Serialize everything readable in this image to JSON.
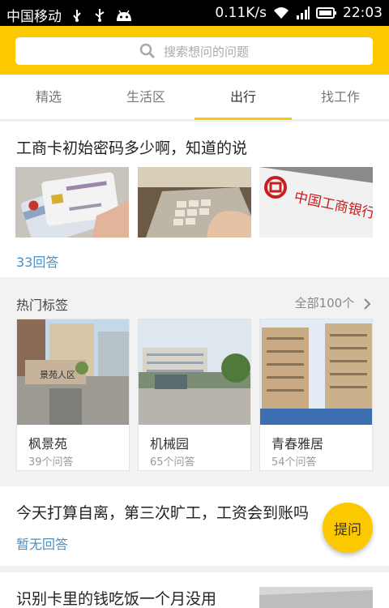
{
  "status_bar": {
    "carrier": "中国移动",
    "speed": "0.11K/s",
    "time": "22:03"
  },
  "search": {
    "placeholder": "搜索想问的问题"
  },
  "tabs": [
    "精选",
    "生活区",
    "出行",
    "找工作"
  ],
  "question1": {
    "title": "工商卡初始密码多少啊，知道的说",
    "answers": "33回答"
  },
  "hot_tags": {
    "heading": "热门标签",
    "all_label": "全部100个",
    "items": [
      {
        "name": "枫景苑",
        "count": "39个问答"
      },
      {
        "name": "机械园",
        "count": "65个问答"
      },
      {
        "name": "青春雅居",
        "count": "54个问答"
      }
    ]
  },
  "question2": {
    "title": "今天打算自离，第三次旷工，工资会到账吗",
    "answers": "暂无回答"
  },
  "question3": {
    "title": "识别卡里的钱吃饭一个月没用"
  },
  "ask_button": {
    "label": "提问"
  },
  "colors": {
    "accent": "#fcc800",
    "link": "#4a90c2"
  }
}
